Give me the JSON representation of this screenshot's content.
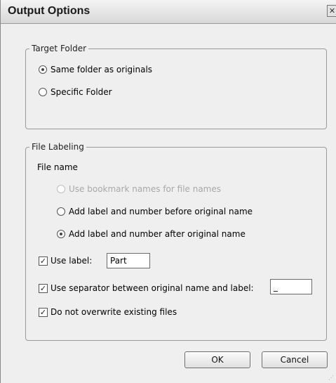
{
  "window": {
    "title": "Output Options",
    "close_symbol": "✕"
  },
  "target_folder": {
    "legend": "Target Folder",
    "options": [
      {
        "label": "Same folder as originals",
        "selected": true
      },
      {
        "label": "Specific Folder",
        "selected": false
      }
    ]
  },
  "file_labeling": {
    "legend": "File Labeling",
    "file_name_heading": "File name",
    "options": [
      {
        "label": "Use bookmark names for file names",
        "selected": false,
        "disabled": true
      },
      {
        "label": "Add label and number before original name",
        "selected": false
      },
      {
        "label": "Add label and number after original name",
        "selected": true
      }
    ],
    "use_label": {
      "label": "Use label:",
      "checked": true,
      "value": "Part"
    },
    "use_separator": {
      "label": "Use separator between original name and label:",
      "checked": true,
      "value": "_"
    },
    "no_overwrite": {
      "label": "Do not overwrite existing files",
      "checked": true
    }
  },
  "buttons": {
    "ok": "OK",
    "cancel": "Cancel"
  }
}
